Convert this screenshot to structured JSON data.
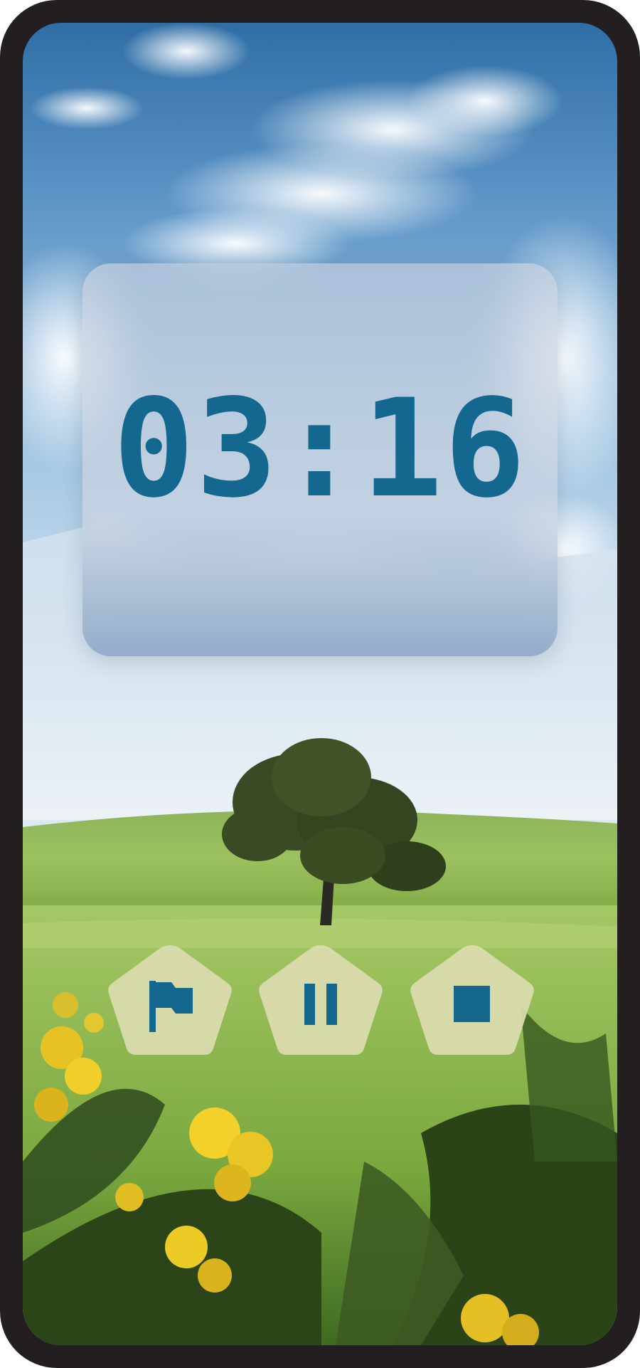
{
  "timer": {
    "display": "03:16"
  },
  "controls": {
    "flag_icon": "flag-icon",
    "pause_icon": "pause-icon",
    "stop_icon": "stop-icon"
  },
  "colors": {
    "accent": "#14678f",
    "frame": "#231f20",
    "button_fill": "#dcdcae"
  }
}
